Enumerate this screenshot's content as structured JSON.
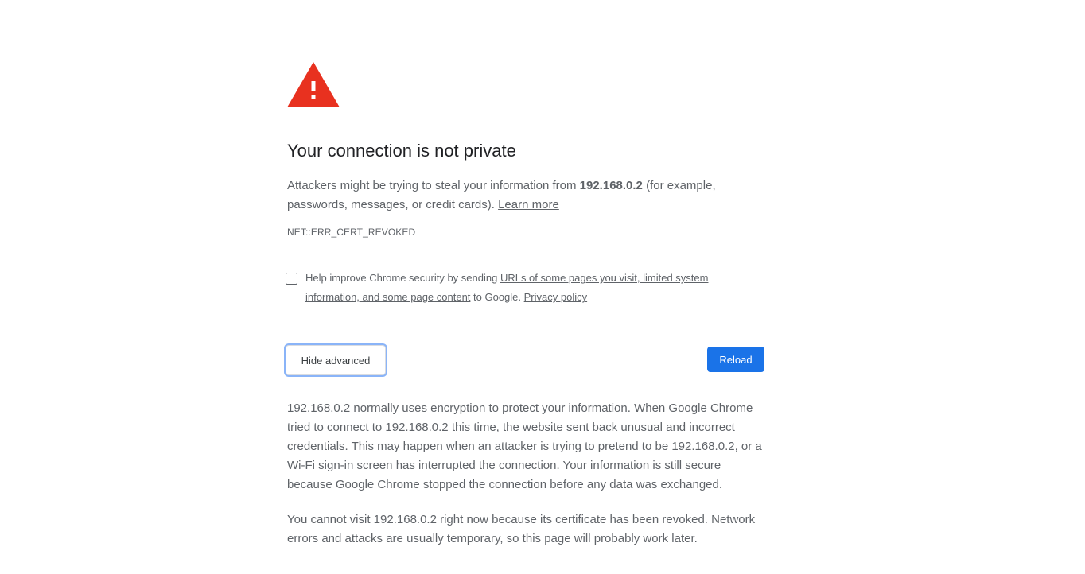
{
  "page": {
    "title": "Your connection is not private",
    "summary_prefix": "Attackers might be trying to steal your information from ",
    "host": "192.168.0.2",
    "summary_suffix": " (for example, passwords, messages, or credit cards). ",
    "learn_more": "Learn more",
    "error_code": "NET::ERR_CERT_REVOKED"
  },
  "optin": {
    "checked": false,
    "text_prefix": "Help improve Chrome security by sending ",
    "link_urls": "URLs of some pages you visit, limited system information, and some page content",
    "text_middle": " to Google. ",
    "link_privacy": "Privacy policy"
  },
  "buttons": {
    "hide_advanced": "Hide advanced",
    "reload": "Reload"
  },
  "details": {
    "paragraph1": "192.168.0.2 normally uses encryption to protect your information. When Google Chrome tried to connect to 192.168.0.2 this time, the website sent back unusual and incorrect credentials. This may happen when an attacker is trying to pretend to be 192.168.0.2, or a Wi-Fi sign-in screen has interrupted the connection. Your information is still secure because Google Chrome stopped the connection before any data was exchanged.",
    "paragraph2": "You cannot visit 192.168.0.2 right now because its certificate has been revoked. Network errors and attacks are usually temporary, so this page will probably work later."
  },
  "colors": {
    "warning_red": "#e8311f",
    "primary_blue": "#1a73e8",
    "text_gray": "#5f6368",
    "heading": "#202124"
  },
  "icons": {
    "warning": "warning-triangle-icon"
  }
}
